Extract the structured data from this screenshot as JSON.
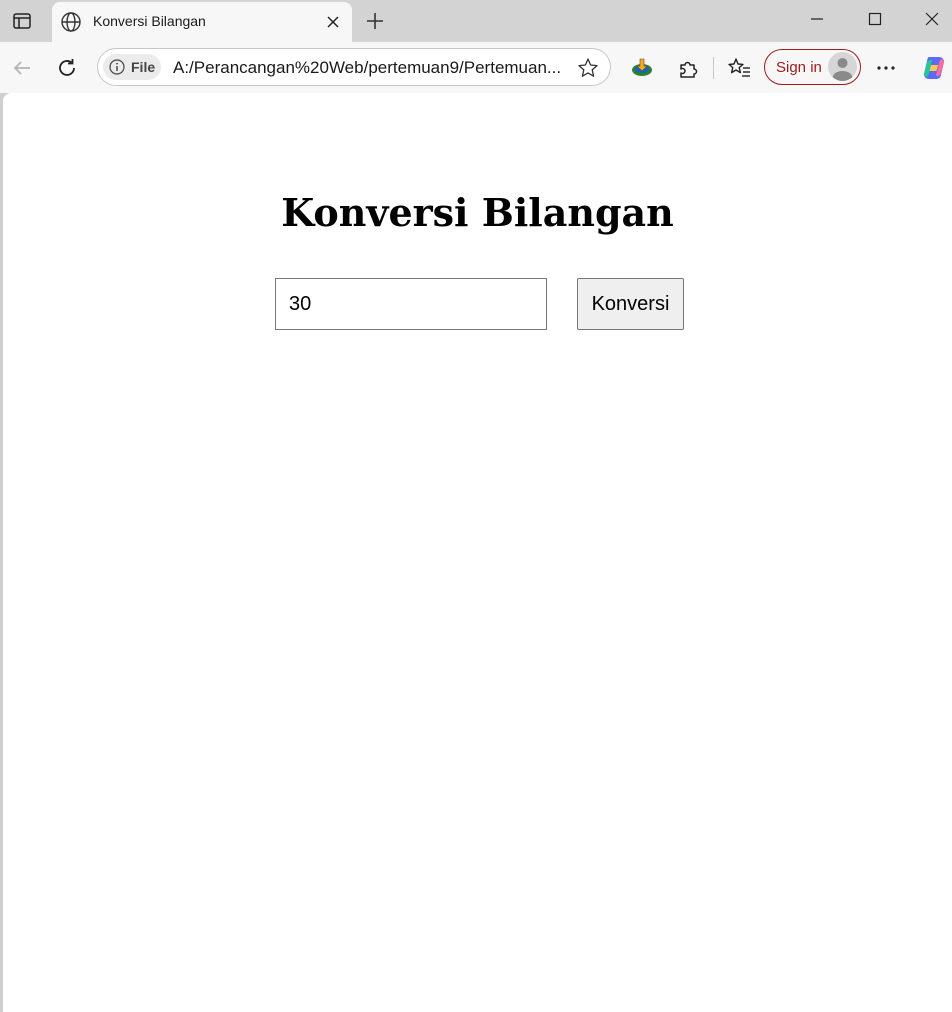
{
  "browser": {
    "tab": {
      "title": "Konversi Bilangan"
    },
    "address_bar": {
      "site_chip": "File",
      "url": "A:/Perancangan%20Web/pertemuan9/Pertemuan..."
    },
    "signin_label": "Sign in",
    "colors": {
      "signin_accent": "#9b1c1c",
      "chrome_bg": "#d3d3d3",
      "toolbar_bg": "#f7f7f7"
    }
  },
  "page": {
    "heading": "Konversi Bilangan",
    "input": {
      "value": "30"
    },
    "button_label": "Konversi"
  }
}
